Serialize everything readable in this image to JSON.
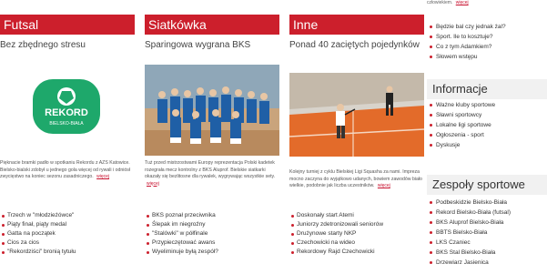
{
  "columns": [
    {
      "category": "Futsal",
      "headline": "Bez zbędnego stresu",
      "teaser": "Pięknacie bramki padło w spotkaniu Rekordu z AZS Katowice. Bielsko-bialski zdobył u jednego gola więcej od rywali i odniósł zwycięstwo na koniec sezonu zasadniczego.",
      "more": "więcej",
      "logo_text": "REKORD",
      "logo_sub": "BIELSKO-BIAŁA",
      "news": [
        "Trzech w \"młodzieżówce\"",
        "Piąty finał, piąty medal",
        "Gatta na początek",
        "Cios za cios",
        "\"Rekordziści\" bronią tytułu"
      ]
    },
    {
      "category": "Siatkówka",
      "headline": "Sparingowa wygrana BKS",
      "teaser": "Tuż przed mistrzostwami Europy reprezentacja Polski kadetek rozegrała mecz kontrolny z BKS Aluprof. Bielskie siatkarki okazały się bezlitosne dla rywalek, wygrywając wszystkie sety.",
      "more": "więcej",
      "news": [
        "BKS poznał przeciwnika",
        "Ślepak im niegroźny",
        "\"Stalówki\" w półfinale",
        "Przypieczętować awans",
        "Wyeliminuje byłą zespół?"
      ]
    },
    {
      "category": "Inne",
      "headline": "Ponad 40 zaciętych pojedynków",
      "teaser": "Kolejny turniej z cyklu Bielskiej Ligi Squasha za nami. Impreza mocno zaczyna do wyjątkowo udanych, bowiem zawodów biało wielkie, podobnie jak liczba uczestników.",
      "more": "więcej",
      "news": [
        "Doskonały start Atemi",
        "Juniorzy zdetronizowali seniorów",
        "Drużynowe starty NKP",
        "Czechowicki na wideo",
        "Rekordowy Rajd Czechowicki"
      ]
    }
  ],
  "top_snippet": "człowiekiem.",
  "top_more": "więcej",
  "sidebar": {
    "polls": [
      "Będzie bal czy jednak żal?",
      "Sport. Ile to kosztuje?",
      "Co z tym Adamkiem?",
      "Słowem wstępu"
    ],
    "info_title": "Informacje",
    "info": [
      "Ważne kluby sportowe",
      "Sławni sportowcy",
      "Lokalne ligi sportowe",
      "Ogłoszenia - sport",
      "Dyskusje"
    ],
    "teams_title": "Zespoły sportowe",
    "teams": [
      "Podbeskidzie Bielsko-Biała",
      "Rekord Bielsko-Biała (futsal)",
      "BKS Aluprof Bielsko-Biała",
      "BBTS Bielsko-Biała",
      "LKS Czaniec",
      "BKS Stal Bielsko-Biała",
      "Drzewiarz Jasienica"
    ]
  },
  "colors": {
    "accent": "#cc1f2c",
    "logo_green": "#1ea86b",
    "court": "#e3692b"
  }
}
